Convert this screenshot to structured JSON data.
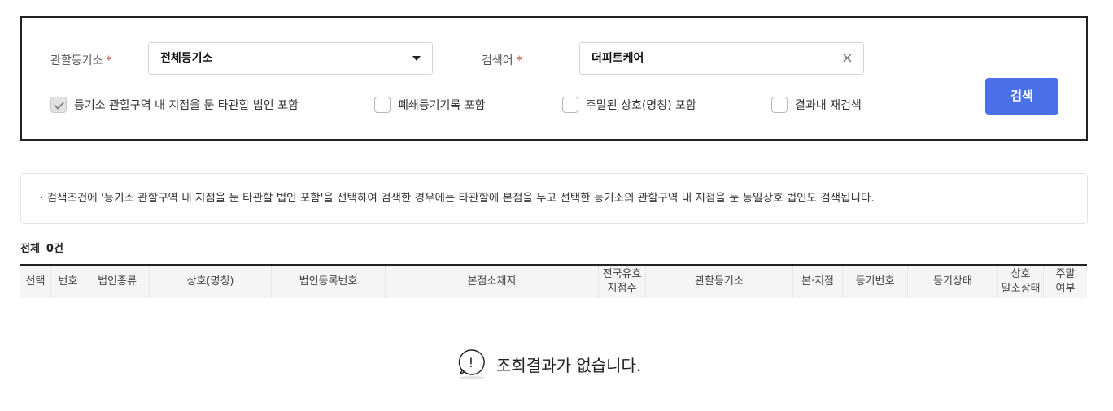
{
  "search": {
    "registry_label": "관할등기소",
    "registry_value": "전체등기소",
    "keyword_label": "검색어",
    "keyword_value": "더피트케어",
    "required_mark": "*",
    "clear_symbol": "×",
    "button_label": "검색",
    "options": [
      {
        "label": "등기소 관할구역 내 지점을 둔 타관할 법인 포함",
        "checked": true
      },
      {
        "label": "폐쇄등기기록 포함",
        "checked": false
      },
      {
        "label": "주말된 상호(명칭) 포함",
        "checked": false
      },
      {
        "label": "결과내 재검색",
        "checked": false
      }
    ]
  },
  "notice": {
    "text": "· 검색조건에 '등기소 관할구역 내 지점을 둔 타관할 법인 포함'을 선택하여 검색한 경우에는 타관할에 본점을 두고 선택한 등기소의 관할구역 내 지점을 둔 동일상호 법인도 검색됩니다."
  },
  "results": {
    "total_label": "전체",
    "total_count": "0건",
    "columns": [
      "선택",
      "번호",
      "법인종류",
      "상호(명칭)",
      "법인등록번호",
      "본점소재지",
      "전국유효\n지점수",
      "관할등기소",
      "본·지점",
      "등기번호",
      "등기상태",
      "상호\n말소상태",
      "주말\n여부"
    ],
    "empty_message": "조회결과가 없습니다.",
    "empty_icon_glyph": "!"
  },
  "colors": {
    "accent": "#4a70e8",
    "required": "#c0392b"
  }
}
